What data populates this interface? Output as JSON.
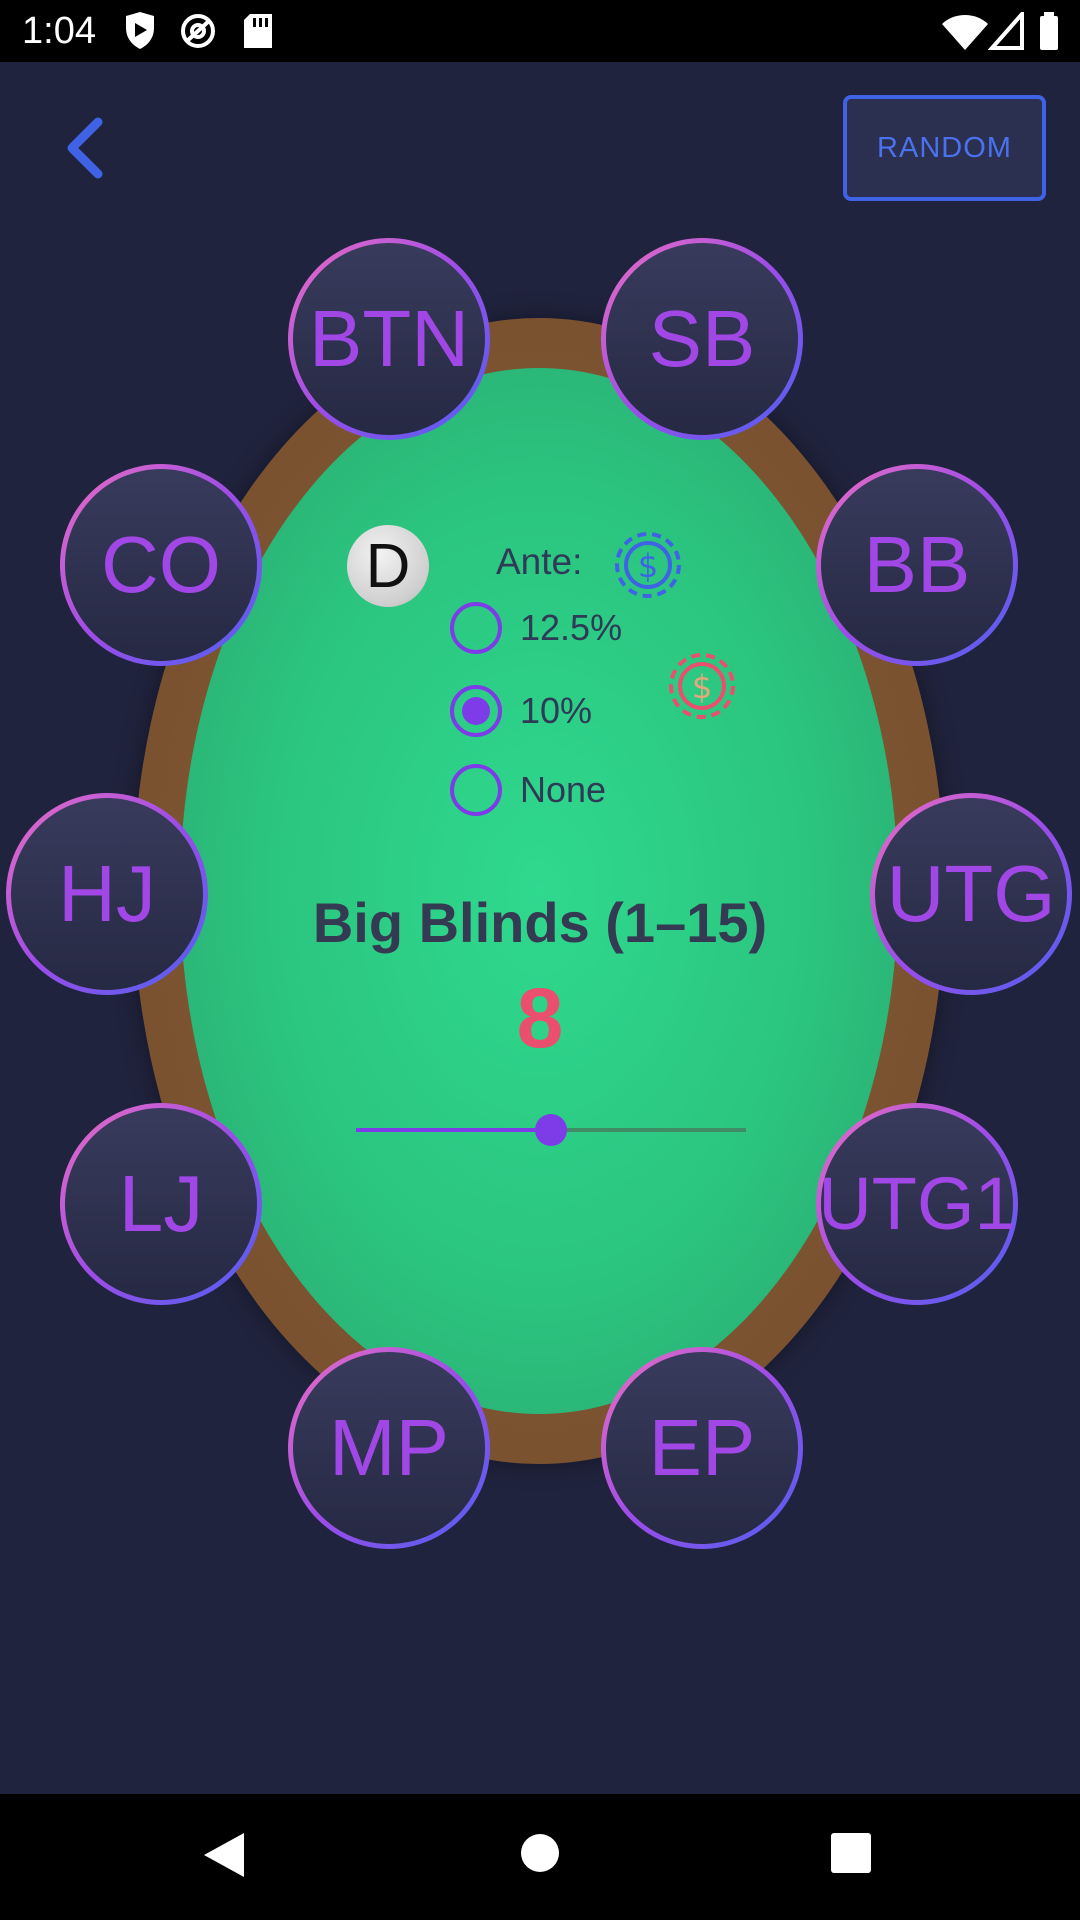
{
  "status_bar": {
    "time": "1:04"
  },
  "header": {
    "random_label": "RANDOM"
  },
  "seats": [
    "BTN",
    "SB",
    "CO",
    "BB",
    "HJ",
    "UTG",
    "LJ",
    "UTG1",
    "MP",
    "EP"
  ],
  "dealer_button": "D",
  "ante": {
    "label": "Ante:",
    "options": [
      "12.5%",
      "10%",
      "None"
    ],
    "selected": "10%"
  },
  "big_blinds": {
    "title": "Big Blinds (1–15)",
    "value": "8",
    "min": 1,
    "max": 15,
    "current": 8
  },
  "colors": {
    "accent_purple": "#7d3ce8",
    "value_red": "#ea4f6d",
    "random_blue": "#3f63e4",
    "felt_green": "#2fd98e",
    "background": "#20233d"
  }
}
